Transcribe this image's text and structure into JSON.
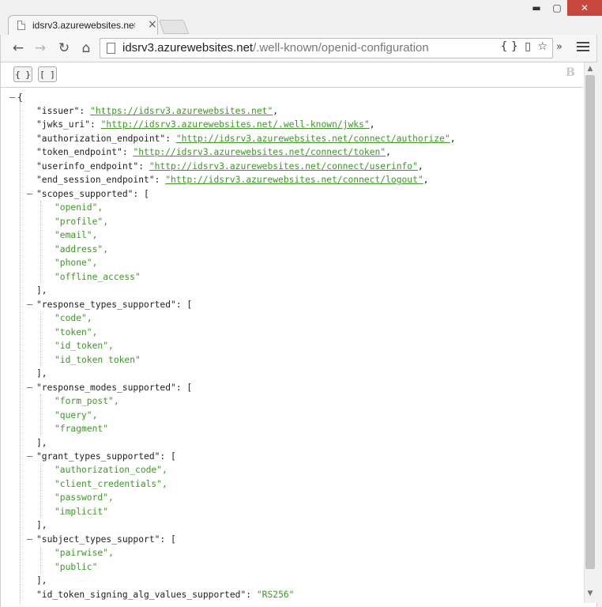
{
  "browser": {
    "tab_title": "idsrv3.azurewebsites.net/.",
    "tab_close": "×",
    "window_controls": {
      "minimize": "▬",
      "maximize": "▢",
      "close": "✕"
    },
    "nav": {
      "back": "←",
      "forward": "→",
      "reload": "↻",
      "home": "⌂"
    },
    "url_host": "idsrv3.azurewebsites.net",
    "url_path": "/.well-known/openid-configuration",
    "omnibox_icons": {
      "json": "{ }",
      "page_action": "▯",
      "bookmark": "☆"
    },
    "extensions_chevron": "»"
  },
  "viewer": {
    "expand_label": "{ }",
    "collapse_label": "[ ]",
    "logo_text": "B"
  },
  "json": {
    "open_brace": "{",
    "issuer": {
      "key": "\"issuer\": ",
      "value": "\"https://idsrv3.azurewebsites.net\"",
      "tail": ","
    },
    "jwks_uri": {
      "key": "\"jwks_uri\": ",
      "value": "\"http://idsrv3.azurewebsites.net/.well-known/jwks\"",
      "tail": ","
    },
    "authorization_endpoint": {
      "key": "\"authorization_endpoint\": ",
      "value": "\"http://idsrv3.azurewebsites.net/connect/authorize\"",
      "tail": ","
    },
    "token_endpoint": {
      "key": "\"token_endpoint\": ",
      "value": "\"http://idsrv3.azurewebsites.net/connect/token\"",
      "tail": ","
    },
    "userinfo_endpoint": {
      "key": "\"userinfo_endpoint\": ",
      "value": "\"http://idsrv3.azurewebsites.net/connect/userinfo\"",
      "tail": ","
    },
    "end_session_endpoint": {
      "key": "\"end_session_endpoint\": ",
      "value": "\"http://idsrv3.azurewebsites.net/connect/logout\"",
      "tail": ","
    },
    "scopes_supported": {
      "key": "\"scopes_supported\": [",
      "items": [
        "\"openid\",",
        "\"profile\",",
        "\"email\",",
        "\"address\",",
        "\"phone\",",
        "\"offline_access\""
      ],
      "close": "],"
    },
    "response_types_supported": {
      "key": "\"response_types_supported\": [",
      "items": [
        "\"code\",",
        "\"token\",",
        "\"id_token\",",
        "\"id_token token\""
      ],
      "close": "],"
    },
    "response_modes_supported": {
      "key": "\"response_modes_supported\": [",
      "items": [
        "\"form_post\",",
        "\"query\",",
        "\"fragment\""
      ],
      "close": "],"
    },
    "grant_types_supported": {
      "key": "\"grant_types_supported\": [",
      "items": [
        "\"authorization_code\",",
        "\"client_credentials\",",
        "\"password\",",
        "\"implicit\""
      ],
      "close": "],"
    },
    "subject_types_support": {
      "key": "\"subject_types_support\": [",
      "items": [
        "\"pairwise\",",
        "\"public\""
      ],
      "close": "],"
    },
    "id_token_signing_alg_values_supported": {
      "key": "\"id_token_signing_alg_values_supported\": ",
      "value": "\"RS256\""
    },
    "toggle_glyph": "–"
  },
  "scrollbar": {
    "up": "▲",
    "down": "▼"
  }
}
